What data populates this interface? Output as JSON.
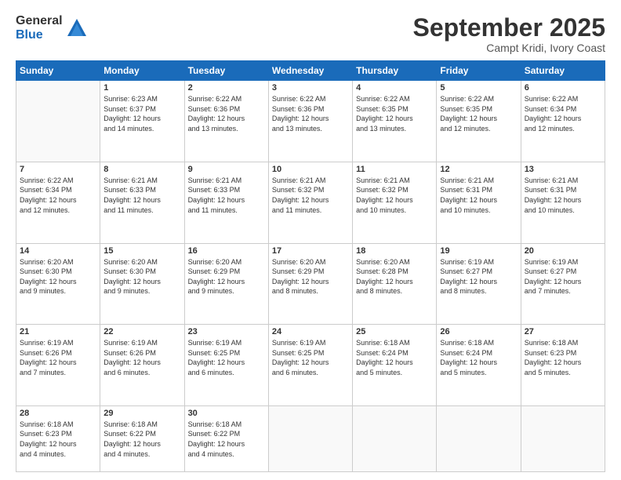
{
  "logo": {
    "general": "General",
    "blue": "Blue"
  },
  "header": {
    "month": "September 2025",
    "location": "Campt Kridi, Ivory Coast"
  },
  "weekdays": [
    "Sunday",
    "Monday",
    "Tuesday",
    "Wednesday",
    "Thursday",
    "Friday",
    "Saturday"
  ],
  "weeks": [
    [
      {
        "day": "",
        "info": ""
      },
      {
        "day": "1",
        "info": "Sunrise: 6:23 AM\nSunset: 6:37 PM\nDaylight: 12 hours\nand 14 minutes."
      },
      {
        "day": "2",
        "info": "Sunrise: 6:22 AM\nSunset: 6:36 PM\nDaylight: 12 hours\nand 13 minutes."
      },
      {
        "day": "3",
        "info": "Sunrise: 6:22 AM\nSunset: 6:36 PM\nDaylight: 12 hours\nand 13 minutes."
      },
      {
        "day": "4",
        "info": "Sunrise: 6:22 AM\nSunset: 6:35 PM\nDaylight: 12 hours\nand 13 minutes."
      },
      {
        "day": "5",
        "info": "Sunrise: 6:22 AM\nSunset: 6:35 PM\nDaylight: 12 hours\nand 12 minutes."
      },
      {
        "day": "6",
        "info": "Sunrise: 6:22 AM\nSunset: 6:34 PM\nDaylight: 12 hours\nand 12 minutes."
      }
    ],
    [
      {
        "day": "7",
        "info": "Sunrise: 6:22 AM\nSunset: 6:34 PM\nDaylight: 12 hours\nand 12 minutes."
      },
      {
        "day": "8",
        "info": "Sunrise: 6:21 AM\nSunset: 6:33 PM\nDaylight: 12 hours\nand 11 minutes."
      },
      {
        "day": "9",
        "info": "Sunrise: 6:21 AM\nSunset: 6:33 PM\nDaylight: 12 hours\nand 11 minutes."
      },
      {
        "day": "10",
        "info": "Sunrise: 6:21 AM\nSunset: 6:32 PM\nDaylight: 12 hours\nand 11 minutes."
      },
      {
        "day": "11",
        "info": "Sunrise: 6:21 AM\nSunset: 6:32 PM\nDaylight: 12 hours\nand 10 minutes."
      },
      {
        "day": "12",
        "info": "Sunrise: 6:21 AM\nSunset: 6:31 PM\nDaylight: 12 hours\nand 10 minutes."
      },
      {
        "day": "13",
        "info": "Sunrise: 6:21 AM\nSunset: 6:31 PM\nDaylight: 12 hours\nand 10 minutes."
      }
    ],
    [
      {
        "day": "14",
        "info": "Sunrise: 6:20 AM\nSunset: 6:30 PM\nDaylight: 12 hours\nand 9 minutes."
      },
      {
        "day": "15",
        "info": "Sunrise: 6:20 AM\nSunset: 6:30 PM\nDaylight: 12 hours\nand 9 minutes."
      },
      {
        "day": "16",
        "info": "Sunrise: 6:20 AM\nSunset: 6:29 PM\nDaylight: 12 hours\nand 9 minutes."
      },
      {
        "day": "17",
        "info": "Sunrise: 6:20 AM\nSunset: 6:29 PM\nDaylight: 12 hours\nand 8 minutes."
      },
      {
        "day": "18",
        "info": "Sunrise: 6:20 AM\nSunset: 6:28 PM\nDaylight: 12 hours\nand 8 minutes."
      },
      {
        "day": "19",
        "info": "Sunrise: 6:19 AM\nSunset: 6:27 PM\nDaylight: 12 hours\nand 8 minutes."
      },
      {
        "day": "20",
        "info": "Sunrise: 6:19 AM\nSunset: 6:27 PM\nDaylight: 12 hours\nand 7 minutes."
      }
    ],
    [
      {
        "day": "21",
        "info": "Sunrise: 6:19 AM\nSunset: 6:26 PM\nDaylight: 12 hours\nand 7 minutes."
      },
      {
        "day": "22",
        "info": "Sunrise: 6:19 AM\nSunset: 6:26 PM\nDaylight: 12 hours\nand 6 minutes."
      },
      {
        "day": "23",
        "info": "Sunrise: 6:19 AM\nSunset: 6:25 PM\nDaylight: 12 hours\nand 6 minutes."
      },
      {
        "day": "24",
        "info": "Sunrise: 6:19 AM\nSunset: 6:25 PM\nDaylight: 12 hours\nand 6 minutes."
      },
      {
        "day": "25",
        "info": "Sunrise: 6:18 AM\nSunset: 6:24 PM\nDaylight: 12 hours\nand 5 minutes."
      },
      {
        "day": "26",
        "info": "Sunrise: 6:18 AM\nSunset: 6:24 PM\nDaylight: 12 hours\nand 5 minutes."
      },
      {
        "day": "27",
        "info": "Sunrise: 6:18 AM\nSunset: 6:23 PM\nDaylight: 12 hours\nand 5 minutes."
      }
    ],
    [
      {
        "day": "28",
        "info": "Sunrise: 6:18 AM\nSunset: 6:23 PM\nDaylight: 12 hours\nand 4 minutes."
      },
      {
        "day": "29",
        "info": "Sunrise: 6:18 AM\nSunset: 6:22 PM\nDaylight: 12 hours\nand 4 minutes."
      },
      {
        "day": "30",
        "info": "Sunrise: 6:18 AM\nSunset: 6:22 PM\nDaylight: 12 hours\nand 4 minutes."
      },
      {
        "day": "",
        "info": ""
      },
      {
        "day": "",
        "info": ""
      },
      {
        "day": "",
        "info": ""
      },
      {
        "day": "",
        "info": ""
      }
    ]
  ]
}
